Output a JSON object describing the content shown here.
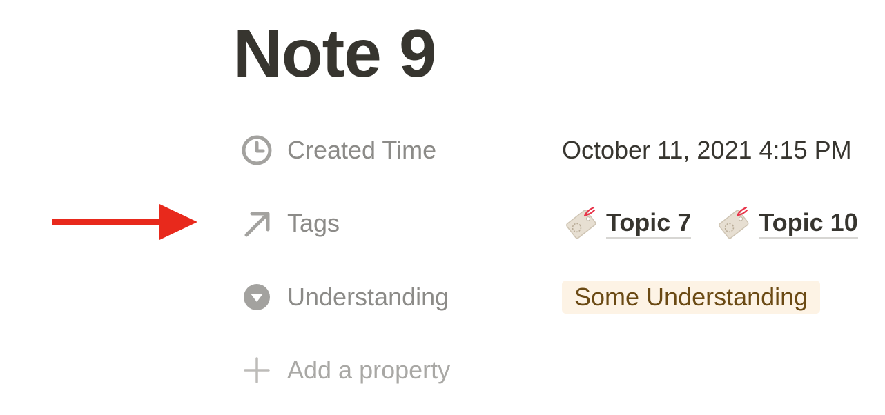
{
  "page": {
    "title": "Note 9"
  },
  "properties": [
    {
      "key": "created",
      "icon": "clock-icon",
      "label": "Created Time",
      "value": "October 11, 2021 4:15 PM"
    },
    {
      "key": "tags",
      "icon": "relation-arrow-icon",
      "label": "Tags",
      "relations": [
        {
          "label": "Topic 7",
          "icon": "tag-icon"
        },
        {
          "label": "Topic 10",
          "icon": "tag-icon"
        }
      ]
    },
    {
      "key": "understanding",
      "icon": "select-dropdown-icon",
      "label": "Understanding",
      "value": "Some Understanding",
      "value_color": "#fdf3e5"
    }
  ],
  "add_property": {
    "icon": "plus-icon",
    "label": "Add a property"
  },
  "annotation": {
    "icon": "red-arrow-icon",
    "color": "#e8291c"
  },
  "colors": {
    "text": "#37352f",
    "muted": "#8c8b88",
    "pill_bg": "#fdf3e5",
    "pill_text": "#6b4a14"
  }
}
